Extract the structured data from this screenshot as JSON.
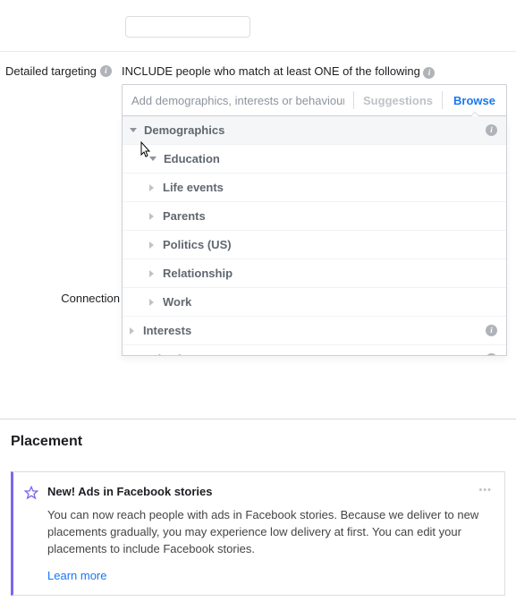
{
  "targeting": {
    "field_label": "Detailed targeting",
    "include_html": "INCLUDE people who match at least ONE of the following",
    "input_placeholder": "Add demographics, interests or behaviours",
    "suggestions_label": "Suggestions",
    "browse_label": "Browse",
    "categories": [
      {
        "label": "Demographics",
        "level": 0,
        "expanded": true,
        "info": true
      },
      {
        "label": "Education",
        "level": 1,
        "expanded": true,
        "info": false
      },
      {
        "label": "Life events",
        "level": 1,
        "expanded": false,
        "info": false
      },
      {
        "label": "Parents",
        "level": 1,
        "expanded": false,
        "info": false
      },
      {
        "label": "Politics (US)",
        "level": 1,
        "expanded": false,
        "info": false
      },
      {
        "label": "Relationship",
        "level": 1,
        "expanded": false,
        "info": false
      },
      {
        "label": "Work",
        "level": 1,
        "expanded": false,
        "info": false
      },
      {
        "label": "Interests",
        "level": 0,
        "expanded": false,
        "info": true
      },
      {
        "label": "Behaviours",
        "level": 0,
        "expanded": false,
        "info": true
      }
    ]
  },
  "connections_label": "Connection",
  "placement": {
    "header": "Placement",
    "callout": {
      "title": "New! Ads in Facebook stories",
      "body": "You can now reach people with ads in Facebook stories. Because we deliver to new placements gradually, you may experience low delivery at first. You can edit your placements to include Facebook stories.",
      "learn_more": "Learn more"
    }
  }
}
